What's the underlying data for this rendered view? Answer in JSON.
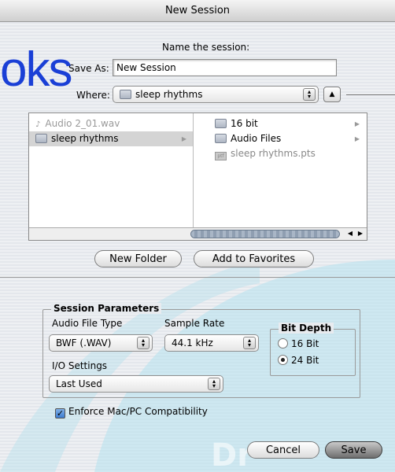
{
  "window": {
    "title": "New Session"
  },
  "overlay_logo_text": "oks",
  "name_prompt": "Name the session:",
  "save_as": {
    "label": "Save As:",
    "value": "New Session"
  },
  "where": {
    "label": "Where:",
    "value": "sleep rhythms"
  },
  "browser": {
    "column1": [
      {
        "label": "Audio 2_01.wav",
        "icon": "audio-file-icon",
        "dimmed": true
      },
      {
        "label": "sleep rhythms",
        "icon": "folder-icon",
        "selected": true
      }
    ],
    "column2": [
      {
        "label": "16 bit",
        "icon": "folder-icon"
      },
      {
        "label": "Audio Files",
        "icon": "folder-icon"
      },
      {
        "label": "sleep rhythms.pts",
        "icon": "session-file-icon",
        "dimmed": true
      }
    ]
  },
  "buttons": {
    "new_folder": "New Folder",
    "add_favorites": "Add to Favorites",
    "cancel": "Cancel",
    "save": "Save"
  },
  "session_params": {
    "title": "Session Parameters",
    "audio_file_type": {
      "label": "Audio File Type",
      "value": "BWF (.WAV)"
    },
    "sample_rate": {
      "label": "Sample Rate",
      "value": "44.1 kHz"
    },
    "io_settings": {
      "label": "I/O Settings",
      "value": "Last Used"
    },
    "bit_depth": {
      "title": "Bit Depth",
      "options": [
        "16 Bit",
        "24 Bit"
      ],
      "selected": "24 Bit"
    }
  },
  "enforce": {
    "label": "Enforce Mac/PC Compatibility",
    "checked": true
  },
  "colors": {
    "logo": "#1a3fd6",
    "accent": "#3d7cd0",
    "bg_wave": "#a7dcec"
  }
}
